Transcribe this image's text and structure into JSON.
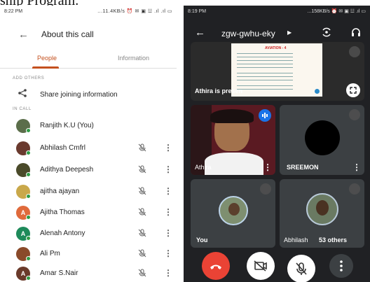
{
  "doc_fragment": {
    "left_text": "ship Program.",
    "right_text": ""
  },
  "left_phone": {
    "status_time": "8:22 PM",
    "status_right": "...11.4KB/s ⏰ ✉ ▣ ☳ .ıl .ıl ▭",
    "header_title": "About this call",
    "tabs": [
      "People",
      "Information"
    ],
    "active_tab": "People",
    "section_add_others": "ADD OTHERS",
    "share_label": "Share joining information",
    "section_in_call": "IN CALL",
    "participants": [
      {
        "name": "Ranjith K.U (You)",
        "avatar": "photo",
        "color": "#5b6e4a"
      },
      {
        "name": "Abhilash Cmfrl",
        "avatar": "photo",
        "color": "#6a3a2e"
      },
      {
        "name": "Adithya Deepesh",
        "avatar": "photo",
        "color": "#4a4a2a"
      },
      {
        "name": "ajitha ajayan",
        "avatar": "photo",
        "color": "#c9a84a"
      },
      {
        "name": "Ajitha Thomas",
        "avatar": "A",
        "color": "#e06a3b"
      },
      {
        "name": "Alenah Antony",
        "avatar": "A",
        "color": "#1e8a5a"
      },
      {
        "name": "Ali Pm",
        "avatar": "photo",
        "color": "#8a4a2a"
      },
      {
        "name": "Amar S.Nair",
        "avatar": "A",
        "color": "#6a3a2a"
      }
    ]
  },
  "right_phone": {
    "status_time": "8:19 PM",
    "status_right": "...158KB/s ⏰ ✉ ▣ ☳ .ıl ▭",
    "meeting_code": "zgw-gwhu-eky",
    "slide_title": "AVIATION - 4",
    "tiles": {
      "presenter": "Athira is presenting",
      "athira": "Athira",
      "sreemon": "SREEMON",
      "you": "You",
      "abhilash": "Abhilash",
      "others": "53 others"
    }
  },
  "colors": {
    "accent": "#c4501e",
    "end_call": "#ea4335",
    "dark_bg": "#202124",
    "tile_bg": "#3c4043",
    "online_dot": "#2e9b44"
  }
}
